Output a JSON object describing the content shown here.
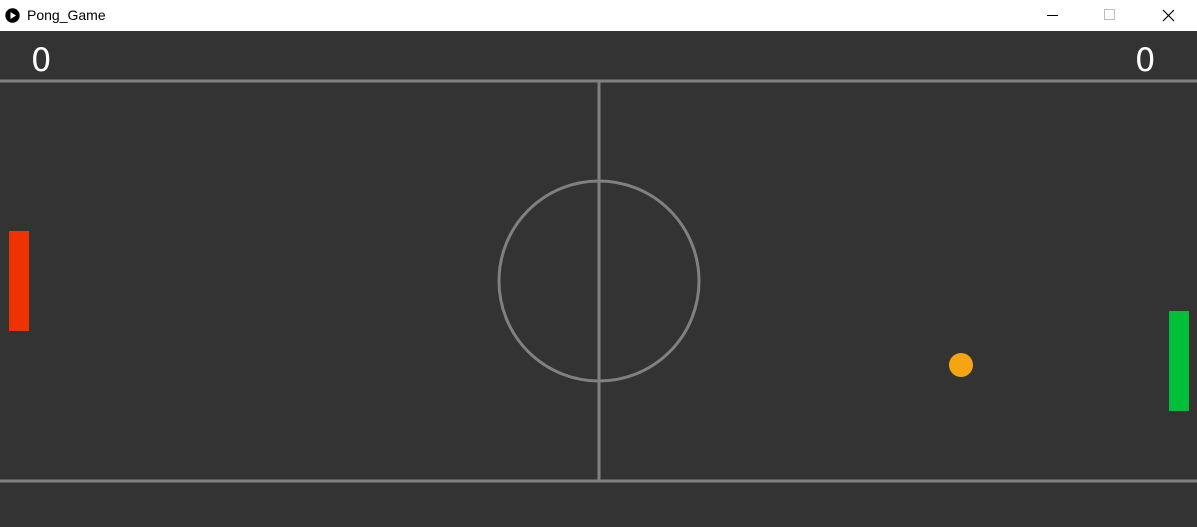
{
  "window": {
    "title": "Pong_Game"
  },
  "scoreboard": {
    "left_score": "0",
    "right_score": "0"
  },
  "colors": {
    "background": "#333333",
    "field_lines": "#808080",
    "left_paddle": "#ee3300",
    "right_paddle": "#00c03a",
    "ball": "#f5a511",
    "score_text": "#ffffff"
  },
  "icons": {
    "app": "play-circle-icon",
    "minimize": "minimize-icon",
    "maximize": "maximize-icon",
    "close": "close-icon"
  }
}
